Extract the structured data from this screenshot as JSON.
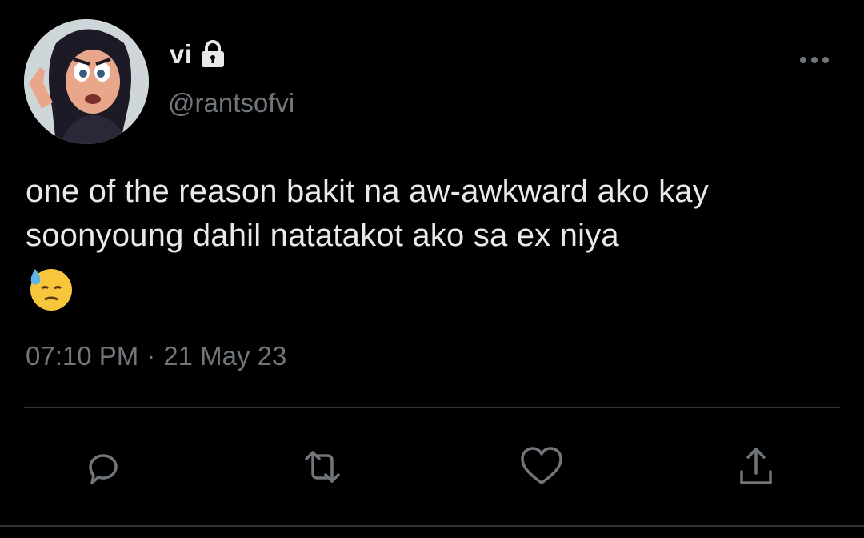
{
  "user": {
    "display_name": "vi",
    "handle": "@rantsofvi",
    "avatar_icon": "cartoon-avatar",
    "protected_icon": "lock-icon"
  },
  "tweet": {
    "text": "one of the reason bakit na aw-awkward ako kay soonyoung dahil natatakot ako sa ex niya",
    "emoji": "😓",
    "time": "07:10 PM",
    "separator": "·",
    "date": "21 May 23"
  },
  "actions": [
    {
      "name": "reply",
      "icon": "speech-bubble-icon"
    },
    {
      "name": "retweet",
      "icon": "retweet-icon"
    },
    {
      "name": "like",
      "icon": "heart-icon"
    },
    {
      "name": "share",
      "icon": "share-icon"
    }
  ],
  "colors": {
    "background": "#000000",
    "primary_text": "#e7e9ea",
    "secondary_text": "#71767b",
    "divider": "#2f3336"
  }
}
